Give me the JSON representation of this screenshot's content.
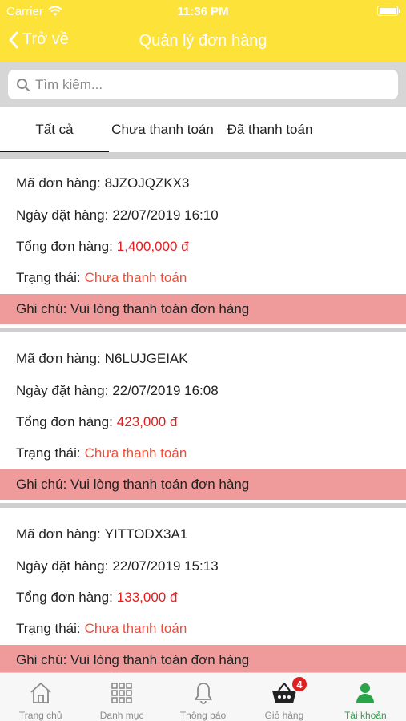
{
  "status_bar": {
    "carrier": "Carrier",
    "time": "11:36 PM"
  },
  "nav": {
    "back_label": "Trở về",
    "title": "Quản lý đơn hàng"
  },
  "search": {
    "placeholder": "Tìm kiếm..."
  },
  "tabs": [
    {
      "label": "Tất cả",
      "active": true
    },
    {
      "label": "Chưa thanh toán",
      "active": false
    },
    {
      "label": "Đã thanh toán",
      "active": false
    }
  ],
  "labels": {
    "order_code": "Mã đơn hàng:",
    "order_date": "Ngày đặt hàng:",
    "order_total": "Tổng đơn hàng:",
    "status": "Trạng thái:",
    "note": "Ghi chú:"
  },
  "orders": [
    {
      "code": "8JZOJQZKX3",
      "date": "22/07/2019 16:10",
      "total": "1,400,000 đ",
      "status": "Chưa thanh toán",
      "note": "Vui lòng thanh toán đơn hàng"
    },
    {
      "code": "N6LUJGEIAK",
      "date": "22/07/2019 16:08",
      "total": "423,000 đ",
      "status": "Chưa thanh toán",
      "note": "Vui lòng thanh toán đơn hàng"
    },
    {
      "code": "YITTODX3A1",
      "date": "22/07/2019 15:13",
      "total": "133,000 đ",
      "status": "Chưa thanh toán",
      "note": "Vui lòng thanh toán đơn hàng"
    }
  ],
  "tab_bar": [
    {
      "label": "Trang chủ",
      "icon": "home-icon",
      "active": false
    },
    {
      "label": "Danh mục",
      "icon": "grid-icon",
      "active": false
    },
    {
      "label": "Thông báo",
      "icon": "bell-icon",
      "active": false
    },
    {
      "label": "Giỏ hàng",
      "icon": "basket-icon",
      "active": false,
      "badge": "4"
    },
    {
      "label": "Tài khoản",
      "icon": "user-icon",
      "active": true
    }
  ],
  "colors": {
    "header": "#fde23a",
    "note_bg": "#ef9b9b",
    "price": "#e02020",
    "status": "#f04e3a",
    "active_tab": "#2aa34a"
  }
}
